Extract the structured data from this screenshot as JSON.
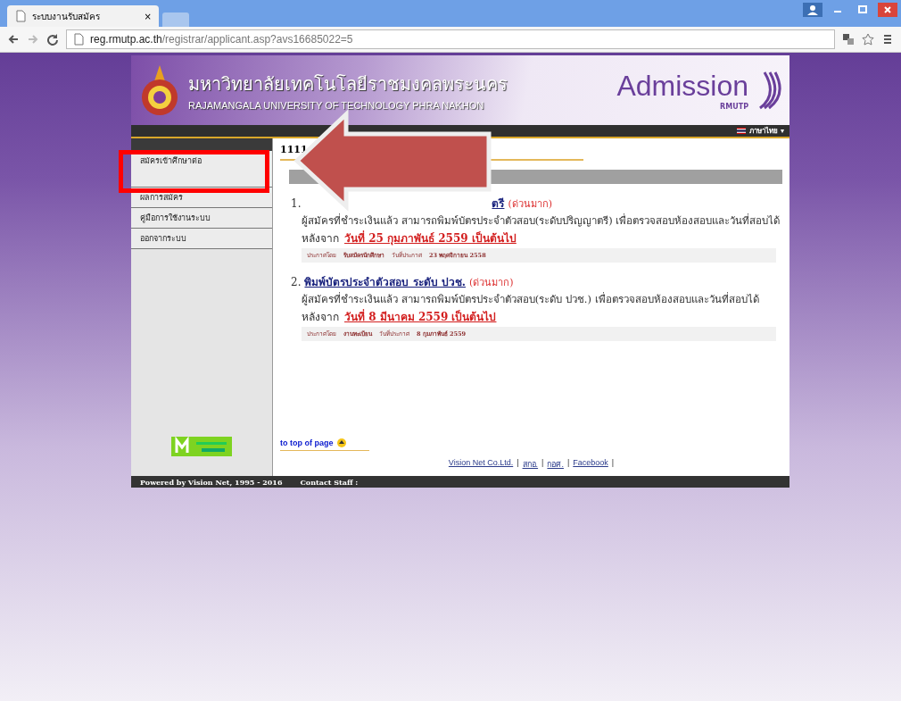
{
  "browser": {
    "tab_title": "ระบบงานรับสมัคร",
    "tab_close": "×",
    "url_host": "reg.rmutp.ac.th",
    "url_path": "/registrar/applicant.asp?avs16685022=5"
  },
  "header": {
    "thai_name": "มหาวิทยาลัยเทคโนโลยีราชมงคลพระนคร",
    "english_name": "RAJAMANGALA UNIVERSITY OF TECHNOLOGY PHRA NAKHON",
    "brand": "Admission",
    "brand_sub": "RMUTP",
    "language": "ภาษาไทย",
    "language_caret": "▾"
  },
  "sidebar": {
    "items": [
      {
        "label": "สมัครเข้าศึกษาต่อ",
        "highlighted": true
      },
      {
        "label": "ผลการสมัคร",
        "highlighted": false
      },
      {
        "label": "คู่มือการใช้งานระบบ",
        "highlighted": false
      },
      {
        "label": "ออกจากระบบ",
        "highlighted": false
      }
    ]
  },
  "content": {
    "heading": "1111",
    "items": [
      {
        "number": "1.",
        "title": "ตรี",
        "kind": "partial",
        "urgent": "(ด่วนมาก)",
        "body": "ผู้สมัครที่ชำระเงินแล้ว สามารถพิมพ์บัตรประจำตัวสอบ(ระดับปริญญาตรี) เพื่อตรวจสอบห้องสอบและวันที่สอบได้",
        "after": "หลังจาก",
        "date_link": "วันที่ 25 กุมภาพันธ์ 2559 เป็นต้นไป",
        "meta": [
          "ประกาศโดย",
          "รับสมัครนักศึกษา",
          "วันที่ประกาศ",
          "23 พฤศจิกายน 2558"
        ]
      },
      {
        "number": "2.",
        "title": "พิมพ์บัตรประจำตัวสอบ ระดับ ปวช.",
        "kind": "full",
        "urgent": "(ด่วนมาก)",
        "body": "ผู้สมัครที่ชำระเงินแล้ว สามารถพิมพ์บัตรประจำตัวสอบ(ระดับ ปวช.) เพื่อตรวจสอบห้องสอบและวันที่สอบได้",
        "after": "หลังจาก",
        "date_link": "วันที่ 8 มีนาคม 2559 เป็นต้นไป",
        "meta": [
          "ประกาศโดย",
          "งานทะเบียน",
          "วันที่ประกาศ",
          "8 กุมภาพันธ์ 2559"
        ]
      }
    ],
    "top_link": "to top of page",
    "footer_links": [
      "Vision Net Co.Ltd.",
      "สกอ.",
      "กอศ.",
      "Facebook"
    ],
    "separator": "|"
  },
  "bottom_bar": {
    "powered": "Powered by Vision Net, 1995 - 2016",
    "contact": "Contact Staff :"
  },
  "annotation": {
    "arrow": true,
    "frame": true
  }
}
